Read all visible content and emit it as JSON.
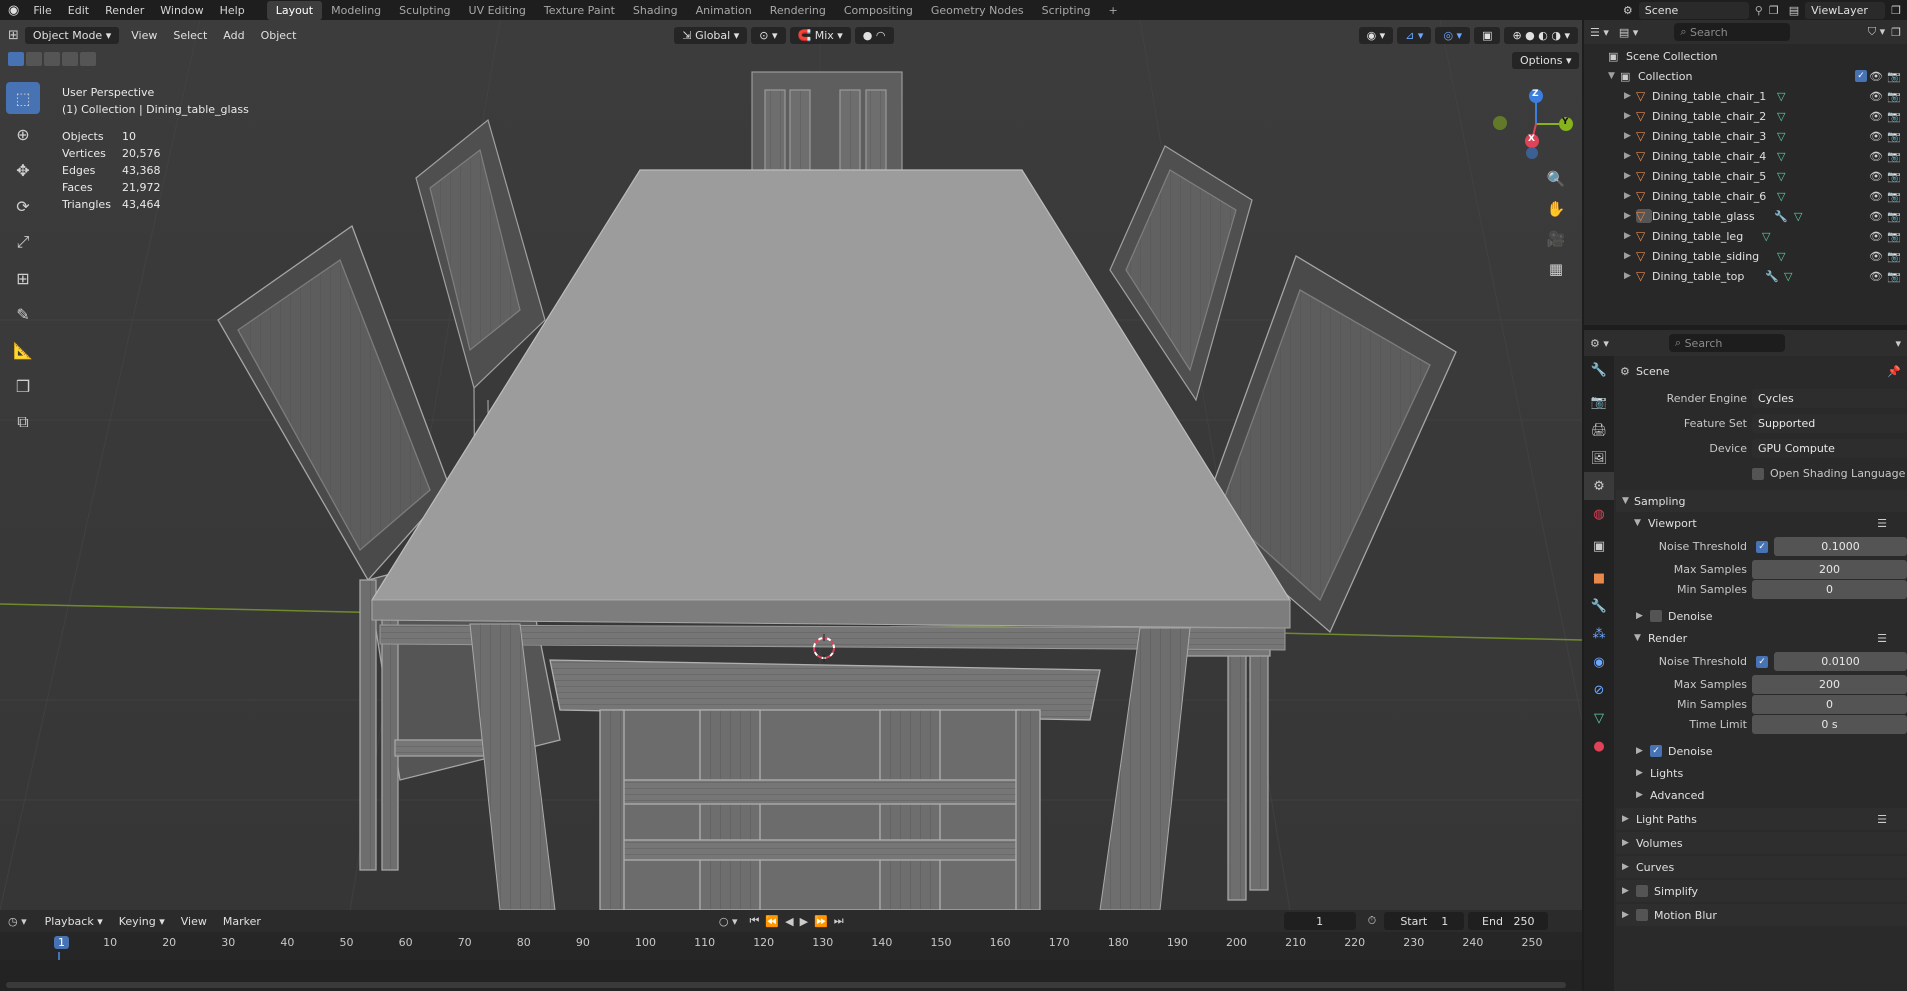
{
  "topbar": {
    "menu": [
      "File",
      "Edit",
      "Render",
      "Window",
      "Help"
    ],
    "workspaces": [
      "Layout",
      "Modeling",
      "Sculpting",
      "UV Editing",
      "Texture Paint",
      "Shading",
      "Animation",
      "Rendering",
      "Compositing",
      "Geometry Nodes",
      "Scripting"
    ],
    "active_workspace": "Layout",
    "add_workspace": "+",
    "scene": "Scene",
    "view_layer": "ViewLayer"
  },
  "viewport": {
    "mode": "Object Mode",
    "menus": [
      "View",
      "Select",
      "Add",
      "Object"
    ],
    "transform_orientation": "Global",
    "snap": "Mix",
    "options": "Options",
    "perspective": "User Perspective",
    "context": "(1) Collection | Dining_table_glass",
    "stats": [
      {
        "label": "Objects",
        "value": "10"
      },
      {
        "label": "Vertices",
        "value": "20,576"
      },
      {
        "label": "Edges",
        "value": "43,368"
      },
      {
        "label": "Faces",
        "value": "21,972"
      },
      {
        "label": "Triangles",
        "value": "43,464"
      }
    ],
    "gizmo_axes": {
      "x": "X",
      "y": "Y",
      "z": "Z"
    }
  },
  "outliner": {
    "search_placeholder": "Search",
    "root": "Scene Collection",
    "collection": "Collection",
    "items": [
      "Dining_table_chair_1",
      "Dining_table_chair_2",
      "Dining_table_chair_3",
      "Dining_table_chair_4",
      "Dining_table_chair_5",
      "Dining_table_chair_6",
      "Dining_table_glass",
      "Dining_table_leg",
      "Dining_table_siding",
      "Dining_table_top"
    ]
  },
  "properties": {
    "search_placeholder": "Search",
    "context": "Scene",
    "render_engine": {
      "label": "Render Engine",
      "value": "Cycles"
    },
    "feature_set": {
      "label": "Feature Set",
      "value": "Supported"
    },
    "device": {
      "label": "Device",
      "value": "GPU Compute"
    },
    "osl": "Open Shading Language",
    "sampling": "Sampling",
    "viewport": {
      "title": "Viewport",
      "noise_threshold_label": "Noise Threshold",
      "noise_threshold": "0.1000",
      "max_samples_label": "Max Samples",
      "max_samples": "200",
      "min_samples_label": "Min Samples",
      "min_samples": "0",
      "denoise": "Denoise"
    },
    "render": {
      "title": "Render",
      "noise_threshold_label": "Noise Threshold",
      "noise_threshold": "0.0100",
      "max_samples_label": "Max Samples",
      "max_samples": "200",
      "min_samples_label": "Min Samples",
      "min_samples": "0",
      "time_limit_label": "Time Limit",
      "time_limit": "0 s",
      "denoise": "Denoise",
      "lights": "Lights",
      "advanced": "Advanced"
    },
    "panels": [
      "Light Paths",
      "Volumes",
      "Curves",
      "Simplify",
      "Motion Blur"
    ]
  },
  "timeline": {
    "menus": [
      "Playback",
      "Keying",
      "View",
      "Marker"
    ],
    "current_frame": "1",
    "start_label": "Start",
    "start": "1",
    "end_label": "End",
    "end": "250",
    "ruler": [
      "1",
      "10",
      "20",
      "30",
      "40",
      "50",
      "60",
      "70",
      "80",
      "90",
      "100",
      "110",
      "120",
      "130",
      "140",
      "150",
      "160",
      "170",
      "180",
      "190",
      "200",
      "210",
      "220",
      "230",
      "240",
      "250"
    ]
  },
  "colors": {
    "accent": "#4772b3",
    "object_icon": "#e6894a",
    "mesh_data": "#5fd1a5",
    "axis_x": "#e04358",
    "axis_y": "#86b31c",
    "axis_z": "#3c7ee0"
  }
}
